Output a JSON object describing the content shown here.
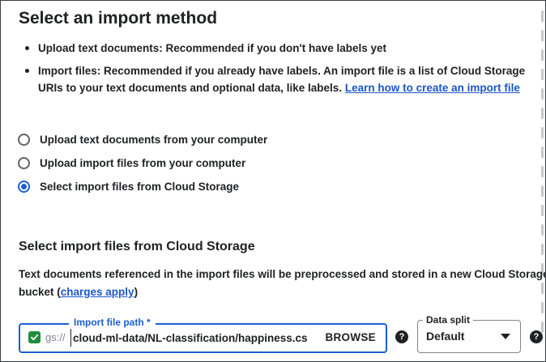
{
  "header": {
    "title": "Select an import method"
  },
  "bullets": [
    {
      "text": "Upload text documents: Recommended if you don't have labels yet"
    },
    {
      "text": "Import files: Recommended if you already have labels. An import file is a list of Cloud Storage URIs to your text documents and optional data, like labels.",
      "link": "Learn how to create an import file"
    }
  ],
  "import_options": {
    "selected_index": 2,
    "items": [
      {
        "label": "Upload text documents from your computer",
        "checked": false
      },
      {
        "label": "Upload import files from your computer",
        "checked": false
      },
      {
        "label": "Select import files from Cloud Storage",
        "checked": true
      }
    ]
  },
  "cloud_storage": {
    "title": "Select import files from Cloud Storage",
    "description_start": "Text documents referenced in the import files will be preprocessed and stored in a new Cloud Storage",
    "description_bucket": "bucket (",
    "charges_link": "charges apply",
    "description_end": ")"
  },
  "import_path": {
    "label": "Import file path *",
    "prefix": "gs://",
    "value": "cloud-ml-data/NL-classification/happiness.cs",
    "browse_label": "BROWSE",
    "valid": true
  },
  "data_split": {
    "label": "Data split",
    "value": "Default"
  },
  "icons": {
    "help": "?",
    "valid_check": "check-icon",
    "dropdown": "caret-down-icon"
  },
  "colors": {
    "accent": "#1a5fd0",
    "link": "#1a56c8",
    "valid": "#1e8e3e",
    "text": "#202124"
  }
}
